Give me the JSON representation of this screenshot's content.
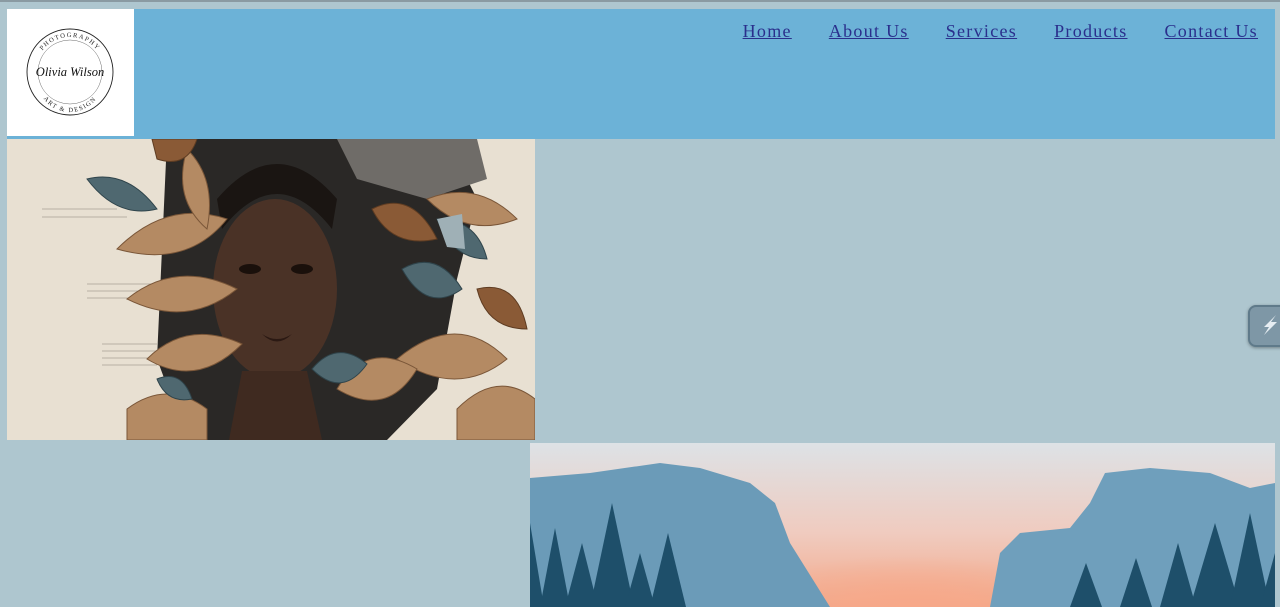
{
  "brand": {
    "logo_top_text": "PHOTOGRAPHY",
    "logo_name": "Olivia Wilson",
    "logo_bottom_text": "ART & DESIGN"
  },
  "nav": {
    "items": [
      {
        "label": "Home"
      },
      {
        "label": "About  Us"
      },
      {
        "label": "Services"
      },
      {
        "label": "Products"
      },
      {
        "label": "Contact  Us"
      }
    ]
  },
  "images": {
    "hero": "collage-portrait-image",
    "landscape": "mountain-valley-image"
  },
  "widgets": {
    "side_icon": "lightning-icon"
  },
  "colors": {
    "page_background": "#aec6cf",
    "header_background": "#6cb2d7",
    "nav_link": "#2a2f8c"
  }
}
